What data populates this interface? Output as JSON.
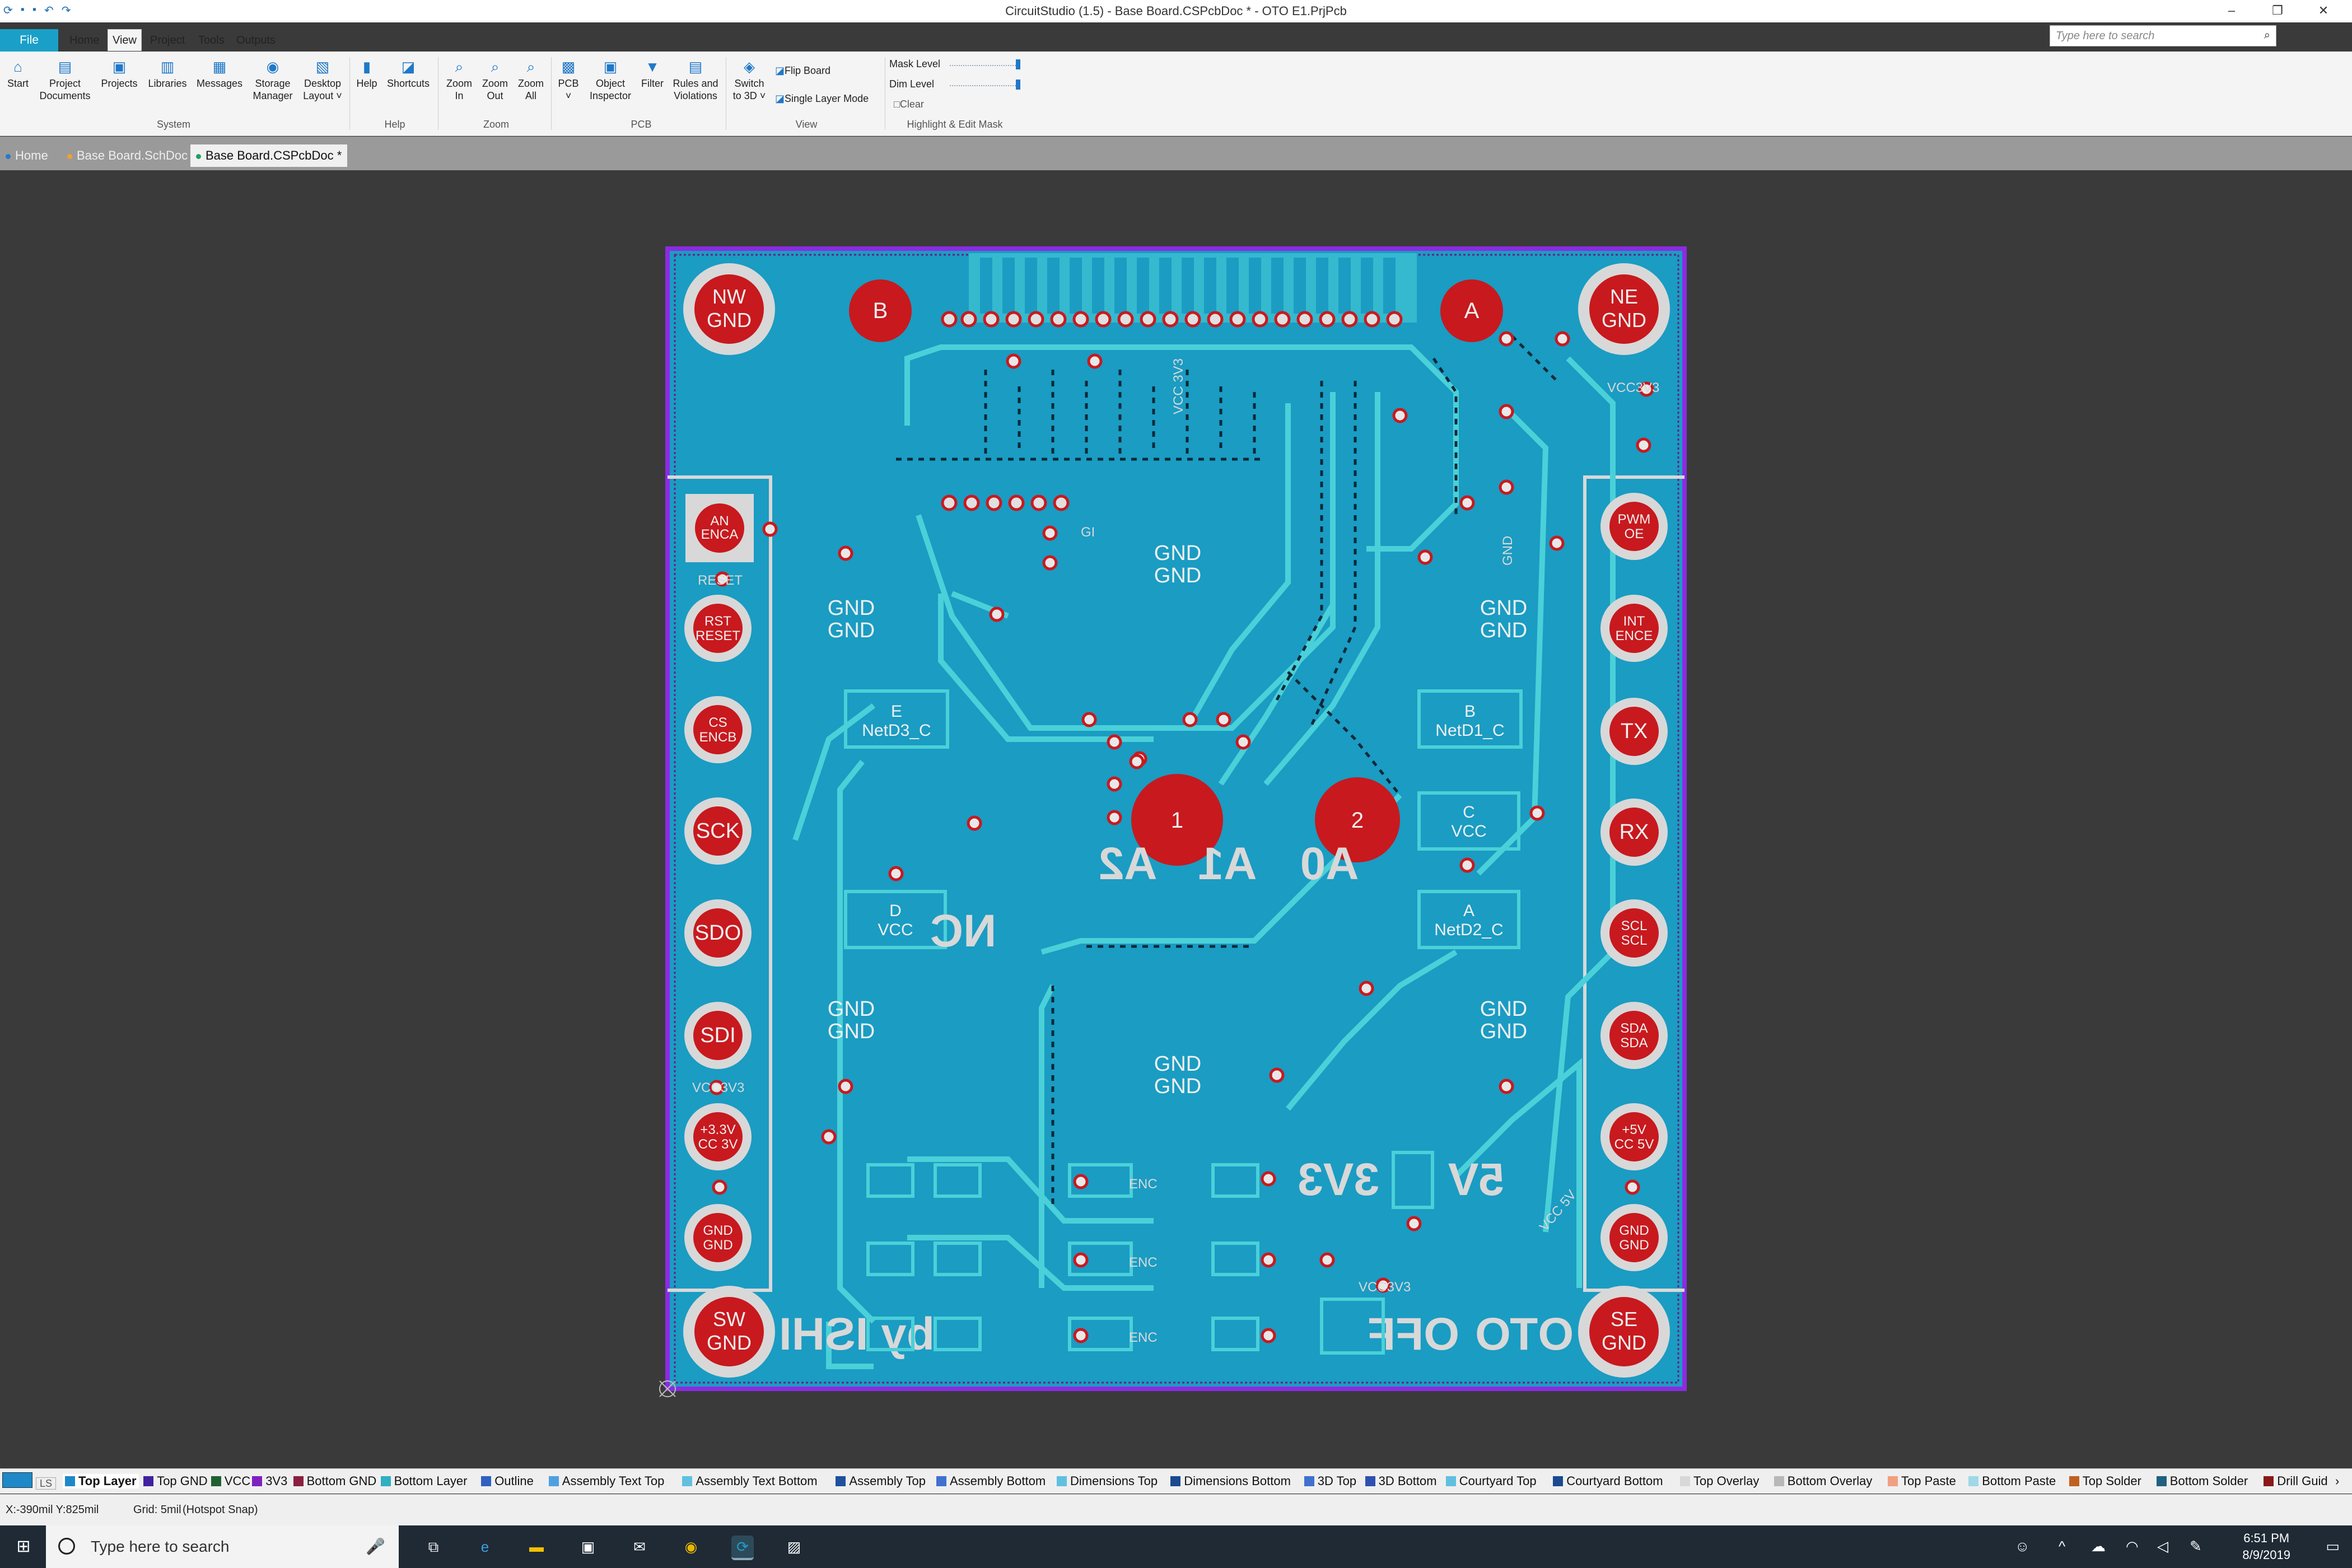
{
  "window": {
    "title": "CircuitStudio (1.5) - Base Board.CSPcbDoc * - OTO E1.PrjPcb",
    "search_placeholder": "Type here to search",
    "controls": [
      "–",
      "❐",
      "✕"
    ]
  },
  "menu": {
    "file": "File",
    "items": [
      "Home",
      "View",
      "Project",
      "Tools",
      "Outputs"
    ],
    "active": "View"
  },
  "ribbon": {
    "buttons": [
      {
        "label1": "Start",
        "label2": ""
      },
      {
        "label1": "Project",
        "label2": "Documents"
      },
      {
        "label1": "Projects",
        "label2": ""
      },
      {
        "label1": "Libraries",
        "label2": ""
      },
      {
        "label1": "Messages",
        "label2": ""
      },
      {
        "label1": "Storage",
        "label2": "Manager"
      },
      {
        "label1": "Desktop",
        "label2": "Layout ˅"
      },
      {
        "label1": "Help",
        "label2": ""
      },
      {
        "label1": "Shortcuts",
        "label2": ""
      },
      {
        "label1": "Zoom",
        "label2": "In"
      },
      {
        "label1": "Zoom",
        "label2": "Out"
      },
      {
        "label1": "Zoom",
        "label2": "All"
      },
      {
        "label1": "PCB",
        "label2": "˅"
      },
      {
        "label1": "Object",
        "label2": "Inspector"
      },
      {
        "label1": "Filter",
        "label2": ""
      },
      {
        "label1": "Rules and",
        "label2": "Violations"
      },
      {
        "label1": "Switch",
        "label2": "to 3D ˅"
      }
    ],
    "groups": [
      "System",
      "Help",
      "Zoom",
      "PCB",
      "View",
      "Highlight & Edit Mask"
    ],
    "flip_board": "Flip Board",
    "single_layer_mode": "Single Layer Mode",
    "mask_level": "Mask Level",
    "dim_level": "Dim Level",
    "clear": "Clear"
  },
  "doc_tabs": [
    {
      "label": "Home",
      "color": "#2a78c8"
    },
    {
      "label": "Base Board.SchDoc",
      "color": "#f0a030"
    },
    {
      "label": "Base Board.CSPcbDoc *",
      "color": "#20a060"
    }
  ],
  "pcb": {
    "mount_holes": [
      {
        "line1": "NW",
        "line2": "GND"
      },
      {
        "line1": "NE",
        "line2": "GND"
      },
      {
        "line1": "SW",
        "line2": "GND"
      },
      {
        "line1": "SE",
        "line2": "GND"
      }
    ],
    "big_pads": [
      "B",
      "A",
      "1",
      "2"
    ],
    "left_header": [
      {
        "line1": "AN",
        "line2": "ENCA"
      },
      {
        "line1": "RST",
        "line2": "RESET"
      },
      {
        "line1": "CS",
        "line2": "ENCB"
      },
      {
        "line1": "SCK",
        "line2": ""
      },
      {
        "line1": "SDO",
        "line2": ""
      },
      {
        "line1": "SDI",
        "line2": ""
      },
      {
        "line1": "+3.3V",
        "line2": "CC 3V"
      },
      {
        "line1": "GND",
        "line2": "GND"
      }
    ],
    "right_header": [
      {
        "line1": "PWM",
        "line2": "OE"
      },
      {
        "line1": "INT",
        "line2": "ENCE"
      },
      {
        "line1": "TX",
        "line2": ""
      },
      {
        "line1": "RX",
        "line2": ""
      },
      {
        "line1": "SCL",
        "line2": "SCL"
      },
      {
        "line1": "SDA",
        "line2": "SDA"
      },
      {
        "line1": "+5V",
        "line2": "CC 5V"
      },
      {
        "line1": "GND",
        "line2": "GND"
      }
    ],
    "gnd_labels": [
      "GND",
      "GND"
    ],
    "pad_boxes": [
      {
        "top": "E",
        "bottom": "NetD3_C"
      },
      {
        "top": "B",
        "bottom": "NetD1_C"
      },
      {
        "top": "C",
        "bottom": "VCC"
      },
      {
        "top": "D",
        "bottom": "VCC"
      },
      {
        "top": "A",
        "bottom": "NetD2_C"
      }
    ],
    "mirror_text": {
      "a2": "A2",
      "a1": "A1",
      "a0": "A0",
      "nc": "NC",
      "v33": "3V3",
      "v5": "5V",
      "off": "OFF",
      "oto": "OTO",
      "byishi": "by ISHI"
    },
    "net_labels": [
      "VCC 3V3",
      "GND",
      "RESET",
      "VCC 5V",
      "GI",
      "ENC",
      "VCC3V3"
    ]
  },
  "layers": [
    {
      "label": "Top Layer",
      "color": "#1e88c8",
      "active": true
    },
    {
      "label": "Top GND",
      "color": "#4020a0"
    },
    {
      "label": "VCC",
      "color": "#206030"
    },
    {
      "label": "3V3",
      "color": "#8020c0"
    },
    {
      "label": "Bottom GND",
      "color": "#8a2040"
    },
    {
      "label": "Bottom Layer",
      "color": "#30b0c0"
    },
    {
      "label": "Outline",
      "color": "#3060c0"
    },
    {
      "label": "Assembly Text Top",
      "color": "#50a0e0"
    },
    {
      "label": "Assembly Text Bottom",
      "color": "#60c0e0"
    },
    {
      "label": "Assembly Top",
      "color": "#2050a0"
    },
    {
      "label": "Assembly Bottom",
      "color": "#4070d0"
    },
    {
      "label": "Dimensions Top",
      "color": "#60c0e0"
    },
    {
      "label": "Dimensions Bottom",
      "color": "#1a4a90"
    },
    {
      "label": "3D Top",
      "color": "#4070d0"
    },
    {
      "label": "3D Bottom",
      "color": "#3050b0"
    },
    {
      "label": "Courtyard Top",
      "color": "#60c0e0"
    },
    {
      "label": "Courtyard Bottom",
      "color": "#1a4a90"
    },
    {
      "label": "Top Overlay",
      "color": "#d8d8d8"
    },
    {
      "label": "Bottom Overlay",
      "color": "#b8b8b8"
    },
    {
      "label": "Top Paste",
      "color": "#f0a080"
    },
    {
      "label": "Bottom Paste",
      "color": "#a0d8e8"
    },
    {
      "label": "Top Solder",
      "color": "#c06020"
    },
    {
      "label": "Bottom Solder",
      "color": "#206080"
    },
    {
      "label": "Drill Guid",
      "color": "#8a1818"
    }
  ],
  "layer_ls": "LS",
  "status": {
    "coords": "X:-390mil Y:825mil",
    "grid": "Grid: 5mil",
    "snap": "(Hotspot Snap)"
  },
  "taskbar": {
    "search": "Type here to search",
    "time": "6:51 PM",
    "date": "8/9/2019"
  },
  "colors": {
    "board": "#1a9cc3",
    "trace": "#4ad0d8",
    "pad_red": "#c8191e",
    "outline": "#8b2be2",
    "ring": "#d8d8d8"
  }
}
